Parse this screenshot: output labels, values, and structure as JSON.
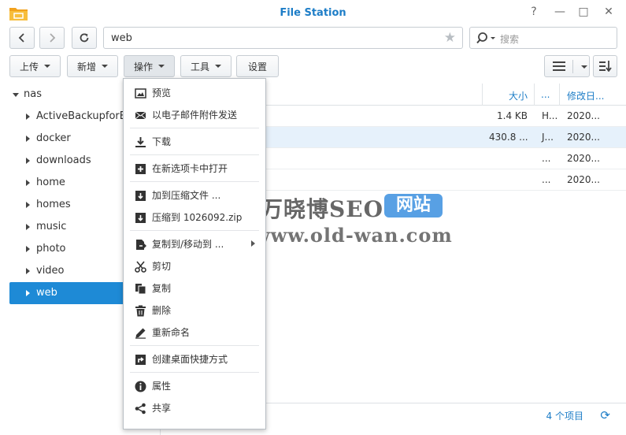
{
  "window": {
    "title": "File Station",
    "controls": [
      "?",
      "—",
      "□",
      "✕"
    ]
  },
  "nav": {
    "path": "web",
    "search_placeholder": "搜索"
  },
  "toolbar": {
    "upload": "上传",
    "create": "新增",
    "action": "操作",
    "tools": "工具",
    "settings": "设置"
  },
  "tree": {
    "root": "nas",
    "items": [
      "ActiveBackupforBusiness",
      "docker",
      "downloads",
      "home",
      "homes",
      "music",
      "photo",
      "video",
      "web"
    ],
    "selected": "web"
  },
  "list": {
    "columns": {
      "size": "大小",
      "type": "...",
      "modified": "修改日..."
    },
    "rows": [
      {
        "size": "1.4 KB",
        "type": "H...",
        "modified": "2020..."
      },
      {
        "size": "430.8 ...",
        "type": "J...",
        "modified": "2020..."
      },
      {
        "size": "",
        "type": "...",
        "modified": "2020..."
      },
      {
        "size": "",
        "type": "...",
        "modified": "2020..."
      }
    ],
    "item_count": "4 个项目"
  },
  "menu": {
    "items": [
      {
        "label": "预览",
        "icon": "image-icon"
      },
      {
        "label": "以电子邮件附件发送",
        "icon": "mail-icon"
      },
      {
        "label": "下载",
        "icon": "download-icon"
      },
      {
        "label": "在新选项卡中打开",
        "icon": "new-tab-icon"
      },
      {
        "label": "加到压缩文件 ...",
        "icon": "compress-icon"
      },
      {
        "label": "压缩到 1026092.zip",
        "icon": "zip-icon"
      },
      {
        "label": "复制到/移动到 ...",
        "icon": "copy-move-icon"
      },
      {
        "label": "剪切",
        "icon": "scissors-icon"
      },
      {
        "label": "复制",
        "icon": "copy-icon"
      },
      {
        "label": "删除",
        "icon": "trash-icon"
      },
      {
        "label": "重新命名",
        "icon": "pencil-icon"
      },
      {
        "label": "创建桌面快捷方式",
        "icon": "shortcut-icon"
      },
      {
        "label": "属性",
        "icon": "info-icon"
      },
      {
        "label": "共享",
        "icon": "share-icon"
      }
    ]
  },
  "watermark": {
    "logo_char": "万",
    "brand": "万晓博SEO",
    "tag": "网站",
    "url": "www.old-wan.com"
  },
  "colors": {
    "accent": "#1e8ad6",
    "title": "#1d7dc7"
  }
}
